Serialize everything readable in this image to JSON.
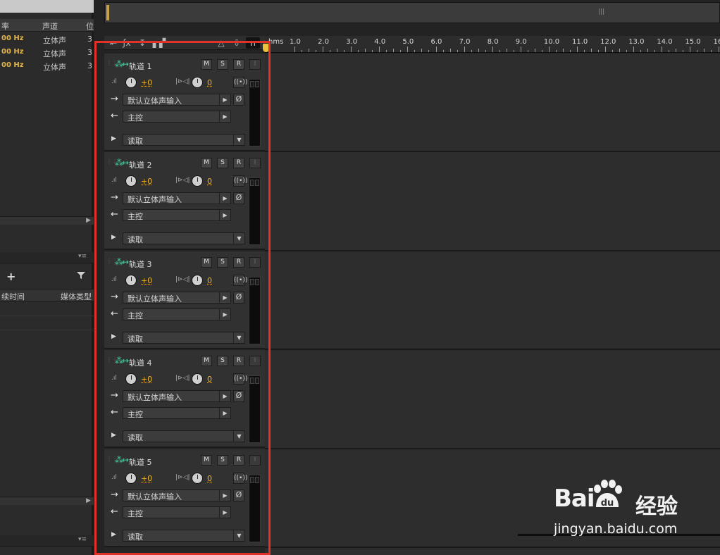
{
  "files_panel": {
    "columns": [
      "率",
      "声道",
      "位"
    ],
    "rows": [
      {
        "rate": "00 Hz",
        "channels": "立体声",
        "bits": "3"
      },
      {
        "rate": "00 Hz",
        "channels": "立体声",
        "bits": "3"
      },
      {
        "rate": "00 Hz",
        "channels": "立体声",
        "bits": "3"
      }
    ]
  },
  "media_panel": {
    "columns": [
      "续时间",
      "媒体类型"
    ],
    "add_icon": "plus-icon",
    "filter_icon": "filter-icon"
  },
  "panel_menu_icon": "▾≡",
  "overview": {
    "grip": "|||"
  },
  "ruler": {
    "unit": "hms",
    "labels": [
      "1.0",
      "2.0",
      "3.0",
      "4.0",
      "5.0",
      "6.0",
      "7.0",
      "8.0",
      "9.0",
      "10.0",
      "11.0",
      "12.0",
      "13.0",
      "14.0",
      "15.0",
      "16"
    ]
  },
  "track_defaults": {
    "mute": "M",
    "solo": "S",
    "record": "R",
    "input_monitor": "I",
    "volume": "+0",
    "pan": "0",
    "input": "默认立体声输入",
    "output": "主控",
    "automation": "读取"
  },
  "tracks": [
    {
      "name": "轨道 1"
    },
    {
      "name": "轨道 2"
    },
    {
      "name": "轨道 3"
    },
    {
      "name": "轨道 4"
    },
    {
      "name": "轨道 5"
    }
  ],
  "watermark": {
    "logo_left": "Bai",
    "logo_paw": "du",
    "logo_cn": "经验",
    "url": "jingyan.baidu.com"
  },
  "colors": {
    "accent_yellow": "#f0b429",
    "track_icon_green": "#3fd1a0",
    "highlight_red": "#e1322a"
  }
}
